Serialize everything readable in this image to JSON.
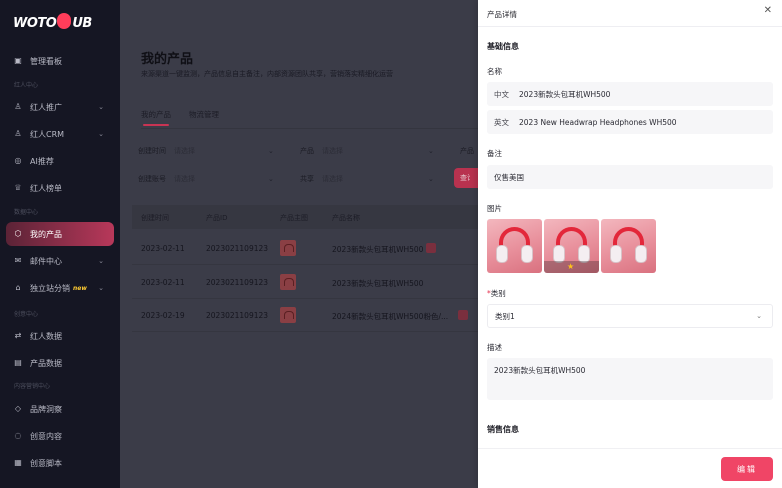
{
  "sidebar": {
    "logo": {
      "pre": "WOTO",
      "post": "UB"
    },
    "items": [
      {
        "label": "管理看板",
        "icon": "dashboard-icon"
      },
      {
        "label": "红人推广",
        "icon": "user-icon",
        "expandable": true
      },
      {
        "label": "红人CRM",
        "icon": "user-icon",
        "expandable": true
      },
      {
        "label": "AI推荐",
        "icon": "ai-icon"
      },
      {
        "label": "红人榜单",
        "icon": "trophy-icon"
      },
      {
        "label": "我的产品",
        "icon": "box-icon",
        "active": true
      },
      {
        "label": "邮件中心",
        "icon": "mail-icon",
        "expandable": true
      },
      {
        "label": "独立站分销",
        "icon": "store-icon",
        "expandable": true,
        "badge": "new"
      },
      {
        "label": "红人数据",
        "icon": "data-icon"
      },
      {
        "label": "产品数据",
        "icon": "chart-icon"
      },
      {
        "label": "品牌洞察",
        "icon": "diamond-icon"
      },
      {
        "label": "创意内容",
        "icon": "bulb-icon"
      },
      {
        "label": "创意脚本",
        "icon": "script-icon"
      }
    ],
    "sections": [
      "红人中心",
      "数据中心",
      "创意中心",
      "内容营销中心"
    ]
  },
  "main": {
    "title": "我的产品",
    "subtitle": "来源渠道一键监测，产品信息自主备注，内部资源团队共享，营销落实精细化运营",
    "tabs": [
      "我的产品",
      "物流管理"
    ],
    "filters": {
      "create_time": "创建时间",
      "create_time_ph": "请选择",
      "product": "产品",
      "product_ph": "请选择",
      "product_more": "产品",
      "create_account": "创建账号",
      "create_account_ph": "请选择",
      "share": "共享",
      "share_ph": "请选择",
      "query": "查询"
    },
    "table": {
      "headers": [
        "创建时间",
        "产品ID",
        "产品主图",
        "产品名称"
      ],
      "rows": [
        {
          "date": "2023-02-11",
          "id": "2023021109123",
          "name": "2023新款头包耳机WH500"
        },
        {
          "date": "2023-02-11",
          "id": "2023021109123",
          "name": "2023新款头包耳机WH500"
        },
        {
          "date": "2023-02-19",
          "id": "2023021109123",
          "name": "2024新款头包耳机WH500粉色/..."
        }
      ]
    }
  },
  "drawer": {
    "title": "产品详情",
    "basic_info": "基础信息",
    "name_label": "名称",
    "name_cn_prefix": "中文",
    "name_cn": "2023新款头包耳机WH500",
    "name_en_prefix": "英文",
    "name_en": "2023 New Headwrap Headphones WH500",
    "note_label": "备注",
    "note": "仅售美国",
    "images_label": "图片",
    "category_label": "类别",
    "category": "类别1",
    "desc_label": "描述",
    "desc": "2023新款头包耳机WH500",
    "sales_info": "销售信息",
    "edit": "编辑"
  }
}
